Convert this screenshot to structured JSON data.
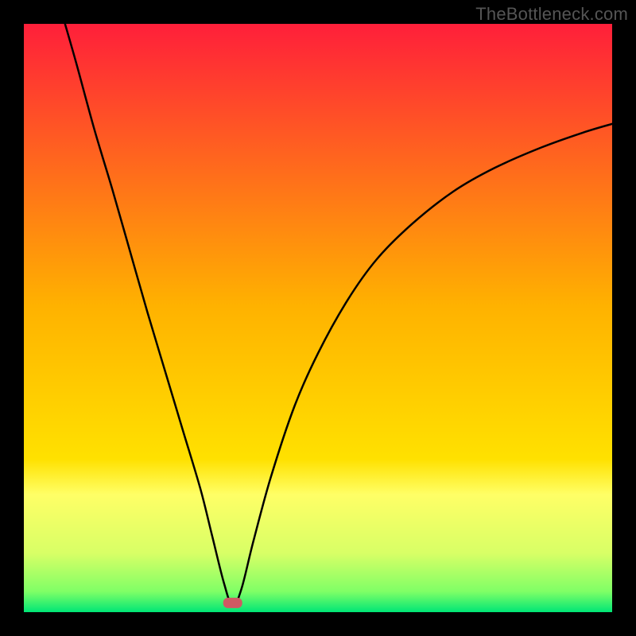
{
  "watermark": {
    "text": "TheBottleneck.com"
  },
  "chart_data": {
    "type": "line",
    "title": "",
    "xlabel": "",
    "ylabel": "",
    "xlim": [
      0,
      100
    ],
    "ylim": [
      0,
      100
    ],
    "grid": false,
    "legend": false,
    "background_gradient": {
      "stops": [
        {
          "offset": 0.0,
          "color": "#ff1f3a"
        },
        {
          "offset": 0.48,
          "color": "#ffb200"
        },
        {
          "offset": 0.74,
          "color": "#ffe100"
        },
        {
          "offset": 0.8,
          "color": "#ffff66"
        },
        {
          "offset": 0.9,
          "color": "#d8ff66"
        },
        {
          "offset": 0.965,
          "color": "#7fff66"
        },
        {
          "offset": 1.0,
          "color": "#00e676"
        }
      ]
    },
    "minimum_marker": {
      "x": 35.5,
      "y": 1.5,
      "color": "#cf5a63"
    },
    "series": [
      {
        "name": "bottleneck-curve",
        "color": "#000000",
        "points": [
          {
            "x": 7.0,
            "y": 100.0
          },
          {
            "x": 9.0,
            "y": 93.0
          },
          {
            "x": 12.0,
            "y": 82.0
          },
          {
            "x": 15.0,
            "y": 72.0
          },
          {
            "x": 18.0,
            "y": 61.5
          },
          {
            "x": 21.0,
            "y": 51.0
          },
          {
            "x": 24.0,
            "y": 41.0
          },
          {
            "x": 27.0,
            "y": 31.0
          },
          {
            "x": 30.0,
            "y": 21.0
          },
          {
            "x": 32.0,
            "y": 13.0
          },
          {
            "x": 34.0,
            "y": 5.0
          },
          {
            "x": 35.5,
            "y": 1.0
          },
          {
            "x": 37.0,
            "y": 4.0
          },
          {
            "x": 39.0,
            "y": 12.0
          },
          {
            "x": 42.0,
            "y": 23.0
          },
          {
            "x": 46.0,
            "y": 35.0
          },
          {
            "x": 50.0,
            "y": 44.0
          },
          {
            "x": 55.0,
            "y": 53.0
          },
          {
            "x": 60.0,
            "y": 60.0
          },
          {
            "x": 66.0,
            "y": 66.0
          },
          {
            "x": 73.0,
            "y": 71.5
          },
          {
            "x": 80.0,
            "y": 75.5
          },
          {
            "x": 88.0,
            "y": 79.0
          },
          {
            "x": 95.0,
            "y": 81.5
          },
          {
            "x": 100.0,
            "y": 83.0
          }
        ]
      }
    ]
  }
}
